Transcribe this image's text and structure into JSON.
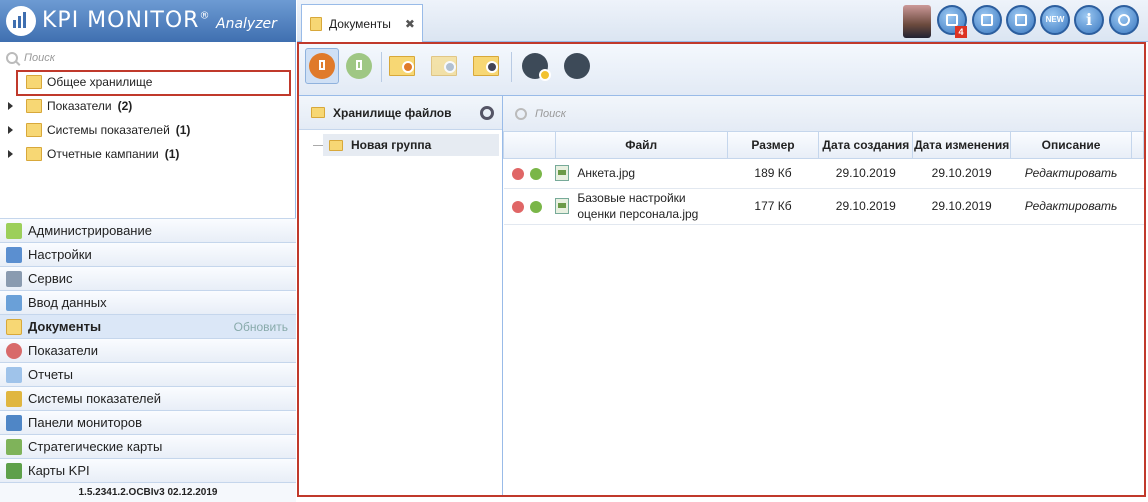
{
  "app": {
    "brand": "KPI MONITOR",
    "registered": "®",
    "subtitle": "Analyzer",
    "version": "1.5.2341.2.OCBIv3  02.12.2019"
  },
  "sidebar": {
    "search_placeholder": "Поиск",
    "tree": [
      {
        "label": "Общее хранилище",
        "count": "",
        "selected": true,
        "icon": "folder-icon"
      },
      {
        "label": "Показатели",
        "count": "(2)",
        "icon": "gauge-folder-icon"
      },
      {
        "label": "Системы показателей",
        "count": "(1)",
        "icon": "hierarchy-folder-icon"
      },
      {
        "label": "Отчетные кампании",
        "count": "(1)",
        "icon": "calendar-folder-icon"
      }
    ],
    "accordion": [
      {
        "label": "Администрирование",
        "icon": "admin-icon"
      },
      {
        "label": "Настройки",
        "icon": "settings-icon"
      },
      {
        "label": "Сервис",
        "icon": "tools-icon"
      },
      {
        "label": "Ввод данных",
        "icon": "data-entry-icon"
      },
      {
        "label": "Документы",
        "icon": "documents-icon",
        "active": true,
        "extra": "Обновить"
      },
      {
        "label": "Показатели",
        "icon": "gauge-icon"
      },
      {
        "label": "Отчеты",
        "icon": "reports-icon"
      },
      {
        "label": "Системы показателей",
        "icon": "hierarchy-icon"
      },
      {
        "label": "Панели мониторов",
        "icon": "dashboard-icon"
      },
      {
        "label": "Стратегические карты",
        "icon": "strategy-map-icon"
      },
      {
        "label": "Карты KPI",
        "icon": "kpi-card-icon"
      }
    ]
  },
  "topbar": {
    "tab_label": "Документы",
    "tab_close": "✖",
    "notification_count": "4",
    "new_badge": "NEW",
    "info_glyph": "i"
  },
  "documents": {
    "storage_title": "Хранилище файлов",
    "group_label": "Новая группа",
    "search_placeholder": "Поиск",
    "columns": [
      "Файл",
      "Размер",
      "Дата создания",
      "Дата изменения",
      "Описание"
    ],
    "rows": [
      {
        "file": "Анкета.jpg",
        "size": "189 Кб",
        "created": "29.10.2019",
        "modified": "29.10.2019",
        "description": "Редактировать"
      },
      {
        "file_line1": "Базовые настройки",
        "file_line2": "оценки персонала.jpg",
        "size": "177 Кб",
        "created": "29.10.2019",
        "modified": "29.10.2019",
        "description": "Редактировать"
      }
    ]
  },
  "colors": {
    "accent_blue": "#3f6fb0",
    "highlight_red": "#c0392b",
    "upload_orange": "#e07a2a",
    "download_green": "#7ab648"
  }
}
